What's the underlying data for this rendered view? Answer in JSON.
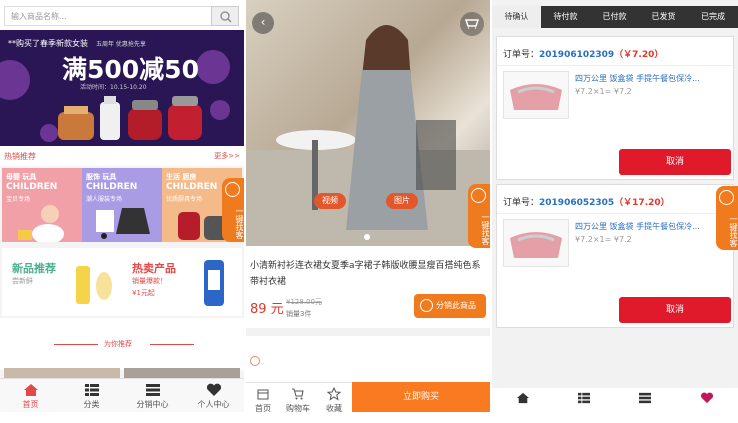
{
  "screen1": {
    "search_placeholder": "输入商品名称...",
    "banner": {
      "top_line": "**购买了春季新款女装",
      "top_line2": "五周年 优惠抢先享",
      "headline": "满500减50",
      "subline": "活动时间：10.15-10.20"
    },
    "hot": {
      "title": "热销推荐",
      "more": "更多>>"
    },
    "categories": [
      {
        "title": "母婴 玩具",
        "en": "CHILDREN",
        "sub": "宝贝专场",
        "color": "#f2a0a8"
      },
      {
        "title": "服饰 玩具",
        "en": "CHILDREN",
        "sub": "潮人服装专场",
        "color": "#a99be4"
      },
      {
        "title": "生活 厨房",
        "en": "CHILDREN",
        "sub": "优质厨具专场",
        "color": "#f4ba8a"
      }
    ],
    "promos": [
      {
        "title": "新品推荐",
        "sub": "尝新鲜",
        "color": "#4bb08e"
      },
      {
        "title": "热卖产品",
        "sub": "销量爆款！",
        "sub2": "¥1元起",
        "color": "#e24a4a"
      }
    ],
    "recommend": "为你推荐",
    "tabs": [
      {
        "label": "首页",
        "icon": "home-icon"
      },
      {
        "label": "分类",
        "icon": "grid-icon"
      },
      {
        "label": "分销中心",
        "icon": "list-icon"
      },
      {
        "label": "个人中心",
        "icon": "heart-icon"
      }
    ],
    "float_tab": "一键找客"
  },
  "screen2": {
    "pill_video": "视频",
    "pill_image": "图片",
    "float_tab": "一键找客",
    "title": "小清新衬衫连衣裙女夏季a字裙子韩版收腰显瘦百搭纯色系带衬衣裙",
    "price": "89 元",
    "old_price": "¥128.00元",
    "sold": "销量3件",
    "share": "分销此商品",
    "tabs": [
      {
        "label": "首页",
        "icon": "shop-icon"
      },
      {
        "label": "购物车",
        "icon": "cart-icon"
      },
      {
        "label": "收藏",
        "icon": "star-icon"
      }
    ],
    "buy": "立即购买"
  },
  "screen3": {
    "tabs": [
      "待确认",
      "待付款",
      "已付款",
      "已发货",
      "已完成"
    ],
    "orders": [
      {
        "label": "订单号：",
        "no": "201906102309",
        "amount": "（￥7.20）",
        "name": "四万公里 饭盒袋 手提午餐包保冷...",
        "qty": "¥7.2×1= ¥7.2",
        "cancel": "取消"
      },
      {
        "label": "订单号：",
        "no": "201906052305",
        "amount": "（￥17.20）",
        "name": "四万公里 饭盒袋 手提午餐包保冷...",
        "qty": "¥7.2×1= ¥7.2",
        "cancel": "取消"
      }
    ],
    "float_tab": "一键找客",
    "tabs_bottom": [
      "home-icon",
      "grid-icon",
      "list-icon",
      "heart-icon"
    ]
  },
  "colors": {
    "accent_red": "#e2362b",
    "orange": "#f07b1e",
    "dark": "#333333"
  }
}
